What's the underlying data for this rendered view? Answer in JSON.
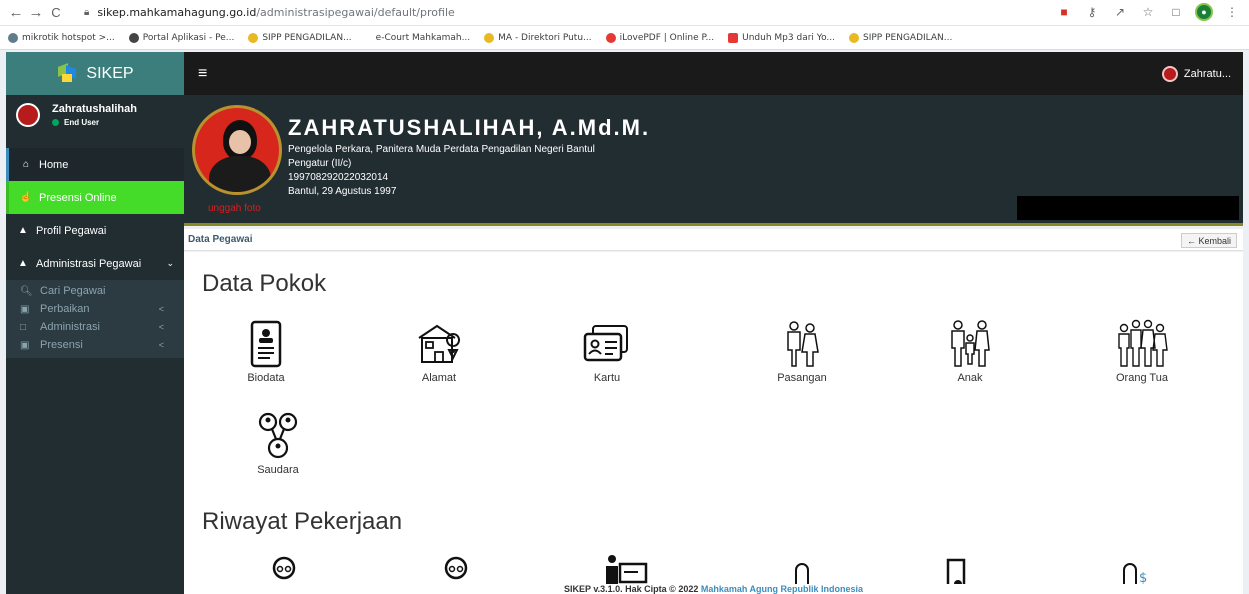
{
  "browser": {
    "url_host": "sikep.mahkamahagung.go.id",
    "url_path": "/administrasipegawai/default/profile",
    "bookmarks": [
      {
        "label": "mikrotik hotspot >...",
        "color": "#607d8b"
      },
      {
        "label": "Portal Aplikasi - Pe...",
        "color": "#444"
      },
      {
        "label": "SIPP PENGADILAN...",
        "color": "#e8b923"
      },
      {
        "label": "e-Court Mahkamah...",
        "color": "#ffffff"
      },
      {
        "label": "MA - Direktori Putu...",
        "color": "#e8b923"
      },
      {
        "label": "iLovePDF | Online P...",
        "color": "#e53935"
      },
      {
        "label": "Unduh Mp3 dari Yo...",
        "color": "#e53935"
      },
      {
        "label": "SIPP PENGADILAN...",
        "color": "#e8b923"
      }
    ]
  },
  "app": {
    "logo_text": "SIKEP",
    "user_short": "Zahratu..."
  },
  "sidebar": {
    "user_name": "Zahratushalihah",
    "user_role": "End User",
    "items": [
      {
        "label": "Home",
        "icon": "home-icon"
      },
      {
        "label": "Presensi Online",
        "icon": "hand-icon"
      },
      {
        "label": "Profil Pegawai",
        "icon": "user-icon"
      },
      {
        "label": "Administrasi Pegawai",
        "icon": "user-icon"
      }
    ],
    "subitems": [
      {
        "label": "Cari Pegawai",
        "icon": "search-icon"
      },
      {
        "label": "Perbaikan",
        "icon": "calendar-icon"
      },
      {
        "label": "Administrasi",
        "icon": "square-icon"
      },
      {
        "label": "Presensi",
        "icon": "calendar-icon"
      }
    ]
  },
  "profile": {
    "name": "ZAHRATUSHALIHAH, A.Md.M.",
    "position": "Pengelola Perkara, Panitera Muda Perdata Pengadilan Negeri Bantul",
    "rank": "Pengatur (II/c)",
    "nip": "199708292022032014",
    "birth": "Bantul, 29 Agustus 1997",
    "upload_label": "unggah foto"
  },
  "breadcrumb": "Data Pegawai",
  "back_label": "← Kembali",
  "data_pokok": {
    "title": "Data Pokok",
    "tiles": [
      "Biodata",
      "Alamat",
      "Kartu",
      "Pasangan",
      "Anak",
      "Orang Tua",
      "Saudara"
    ]
  },
  "riwayat": {
    "title": "Riwayat Pekerjaan"
  },
  "footer": {
    "text": "SIKEP v.3.1.0. Hak Cipta © 2022 ",
    "link": "Mahkamah Agung Republik Indonesia"
  }
}
